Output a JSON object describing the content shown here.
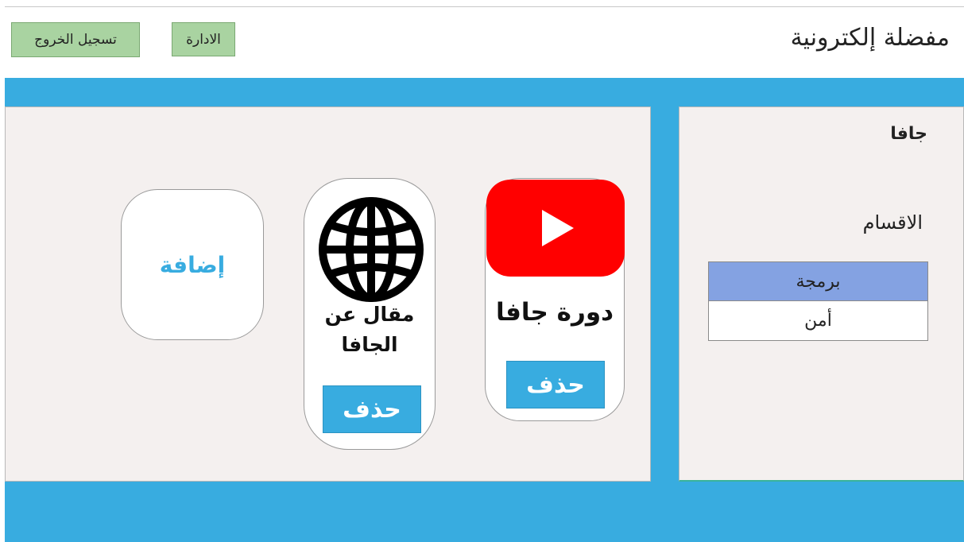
{
  "header": {
    "title": "مفضلة إلكترونية",
    "logout_label": "تسجيل الخروج",
    "admin_label": "الادارة"
  },
  "main": {
    "category_title": "جافا",
    "cards": [
      {
        "title": "دورة جافا",
        "icon": "youtube-play-icon",
        "delete_label": "حذف"
      },
      {
        "title": "مقال عن الجافا",
        "icon": "globe-icon",
        "delete_label": "حذف"
      }
    ],
    "add_label": "إضافة"
  },
  "sidebar": {
    "heading": "الاقسام",
    "items": [
      {
        "label": "برمجة",
        "selected": true
      },
      {
        "label": "أمن",
        "selected": false
      }
    ]
  },
  "colors": {
    "accent": "#38ace0",
    "header_button": "#a9d3a1",
    "selected_item": "#84a2e2",
    "panel": "#f4f0ef",
    "youtube_red": "#ff0000"
  }
}
